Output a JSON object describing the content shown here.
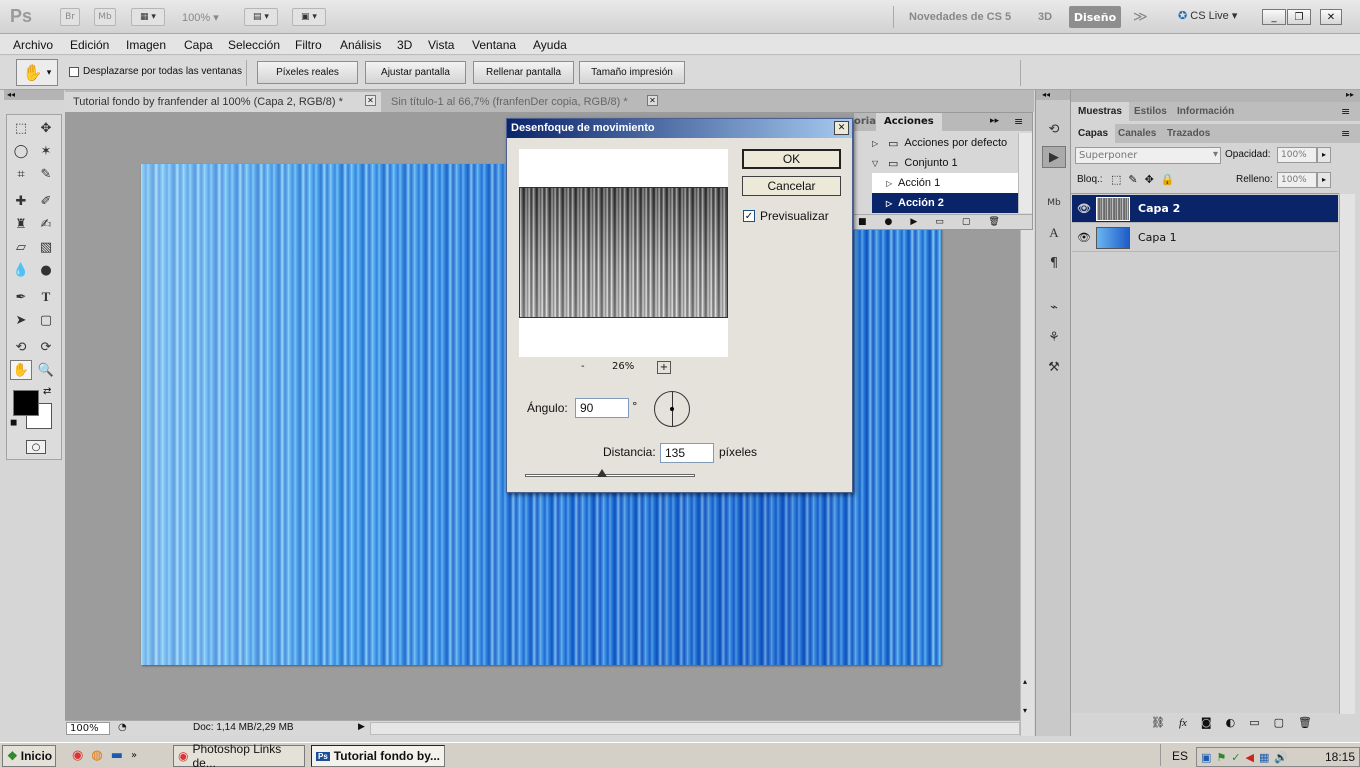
{
  "appbar": {
    "logo": "Ps",
    "bridge": "Br",
    "minibridge": "Mb",
    "zoom": "100%",
    "novedades": "Novedades de CS 5",
    "threed": "3D",
    "diseno": "Diseño",
    "cslive": "CS Live"
  },
  "menu": [
    "Archivo",
    "Edición",
    "Imagen",
    "Capa",
    "Selección",
    "Filtro",
    "Análisis",
    "3D",
    "Vista",
    "Ventana",
    "Ayuda"
  ],
  "options": {
    "scroll_all_label": "Desplazarse por todas las ventanas",
    "btn_actual_pixels": "Píxeles reales",
    "btn_fit_screen": "Ajustar pantalla",
    "btn_fill_screen": "Rellenar pantalla",
    "btn_print_size": "Tamaño impresión"
  },
  "tabs": [
    {
      "label": "Tutorial fondo by franfender al 100% (Capa 2, RGB/8) *"
    },
    {
      "label": "Sin título-1 al 66,7% (franfenDer copia, RGB/8) *"
    }
  ],
  "status": {
    "zoom": "100%",
    "doc": "Doc: 1,14 MB/2,29 MB"
  },
  "dialog": {
    "title": "Desenfoque de movimiento",
    "ok": "OK",
    "cancel": "Cancelar",
    "preview_label": "Previsualizar",
    "preview_checked": true,
    "zoom_minus": "-",
    "zoom_value": "26%",
    "zoom_plus": "+",
    "angle_label": "Ángulo:",
    "angle_value": "90",
    "angle_unit": "°",
    "distance_label": "Distancia:",
    "distance_value": "135",
    "distance_unit": "píxeles",
    "distance_slider_fraction": 0.45
  },
  "actions_panel": {
    "tab_left": "oria",
    "tab_active": "Acciones",
    "rows": [
      {
        "label": "Acciones por defecto"
      },
      {
        "label": "Conjunto 1"
      },
      {
        "label": "Acción 1"
      },
      {
        "label": "Acción 2"
      }
    ]
  },
  "right_panel": {
    "top_tabs": [
      "Muestras",
      "Estilos",
      "Información"
    ],
    "layer_tabs": [
      "Capas",
      "Canales",
      "Trazados"
    ],
    "blend_mode": "Superponer",
    "opacity_label": "Opacidad:",
    "opacity_value": "100%",
    "lock_label": "Bloq.:",
    "fill_label": "Relleno:",
    "fill_value": "100%",
    "layers": [
      {
        "name": "Capa 2",
        "selected": true
      },
      {
        "name": "Capa 1",
        "selected": false
      }
    ]
  },
  "taskbar": {
    "start": "Inicio",
    "tasks": [
      "Photoshop Links de...",
      "Tutorial fondo by..."
    ],
    "lang": "ES",
    "time": "18:15"
  }
}
